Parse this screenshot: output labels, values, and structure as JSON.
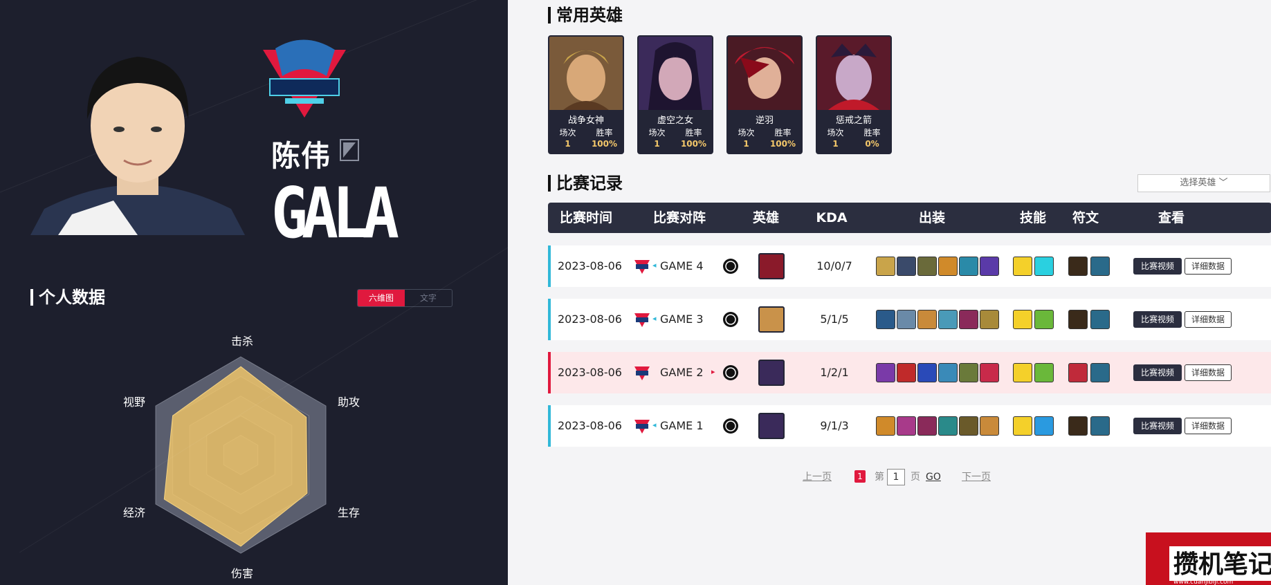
{
  "player": {
    "real_name": "陈伟",
    "game_id": "GALA",
    "team": "LNG ESPORTS",
    "position_icon": "adc-position-icon"
  },
  "personal": {
    "title": "个人数据",
    "toggle": [
      "六维图",
      "文字"
    ],
    "active_toggle": 0,
    "radar_labels": [
      "击杀",
      "助攻",
      "生存",
      "伤害",
      "经济",
      "视野"
    ],
    "radar_values": [
      0.9,
      0.77,
      0.78,
      0.93,
      0.9,
      0.8
    ]
  },
  "heroes": {
    "title": "常用英雄",
    "stat_labels": [
      "场次",
      "胜率"
    ],
    "items": [
      {
        "name": "战争女神",
        "games": "1",
        "winrate": "100%",
        "art": "sivir"
      },
      {
        "name": "虚空之女",
        "games": "1",
        "winrate": "100%",
        "art": "kaisa"
      },
      {
        "name": "逆羽",
        "games": "1",
        "winrate": "100%",
        "art": "xayah"
      },
      {
        "name": "惩戒之箭",
        "games": "1",
        "winrate": "0%",
        "art": "varus"
      }
    ]
  },
  "records": {
    "title": "比赛记录",
    "hero_select": "选择英雄 ﹀",
    "headers": [
      "比赛时间",
      "比赛对阵",
      "英雄",
      "KDA",
      "出装",
      "技能",
      "符文",
      "查看"
    ],
    "btn_video": "比赛视频",
    "btn_detail": "详细数据",
    "rows": [
      {
        "date": "2023-08-06",
        "game": "GAME 4",
        "kda": "10/0/7",
        "result": "win",
        "hero": "xayah"
      },
      {
        "date": "2023-08-06",
        "game": "GAME 3",
        "kda": "5/1/5",
        "result": "win",
        "hero": "sivir"
      },
      {
        "date": "2023-08-06",
        "game": "GAME 2",
        "kda": "1/2/1",
        "result": "loss",
        "hero": "varus"
      },
      {
        "date": "2023-08-06",
        "game": "GAME 1",
        "kda": "9/1/3",
        "result": "win",
        "hero": "kaisa"
      }
    ]
  },
  "pager": {
    "prev": "上一页",
    "current": "1",
    "page_prefix": "第",
    "page_input": "1",
    "page_suffix": "页",
    "go": "GO",
    "next": "下一页"
  },
  "watermark": {
    "text": "攒机笔记",
    "url": "www.cuanjibiji.com"
  },
  "colors": {
    "accent": "#e0193e",
    "dark": "#1d1f2d",
    "win": "#31b8d8",
    "radar": "#f4c86a"
  }
}
